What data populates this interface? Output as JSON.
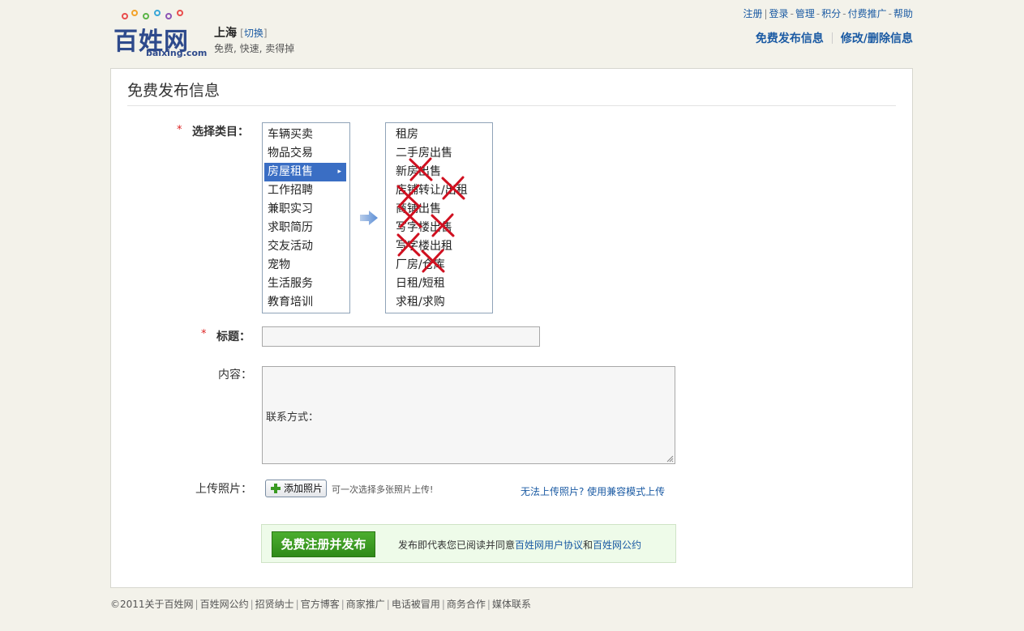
{
  "header": {
    "logo_text": "百姓网",
    "logo_domain": "baixing.com",
    "city": "上海",
    "switch_label": "切换",
    "slogan": "免费, 快速, 卖得掉",
    "top_links": [
      "注册",
      "登录",
      "管理",
      "积分",
      "付费推广",
      "帮助"
    ],
    "main_links": [
      "免费发布信息",
      "修改/删除信息"
    ]
  },
  "form": {
    "heading": "免费发布信息",
    "category_label": "选择类目：",
    "categories": [
      "车辆买卖",
      "物品交易",
      "房屋租售",
      "工作招聘",
      "兼职实习",
      "求职简历",
      "交友活动",
      "宠物",
      "生活服务",
      "教育培训"
    ],
    "selected_category": "房屋租售",
    "subcategories": [
      "租房",
      "二手房出售",
      "新房出售",
      "店铺转让/出租",
      "商铺出售",
      "写字楼出售",
      "写字楼出租",
      "厂房/仓库",
      "日租/短租",
      "求租/求购"
    ],
    "title_label": "标题：",
    "title_value": "",
    "content_label": "内容：",
    "content_value": "联系方式：",
    "photo_label": "上传照片：",
    "photo_button": "添加照片",
    "photo_hint": "可一次选择多张照片上传!",
    "photo_compat_link": "无法上传照片? 使用兼容模式上传",
    "submit_button": "免费注册并发布",
    "agree_prefix": "发布即代表您已阅读并同意",
    "agree_link1": "百姓网用户协议",
    "agree_and": "和",
    "agree_link2": "百姓网公约"
  },
  "footer": {
    "copyright": "©2011关于百姓网",
    "links": [
      "百姓网公约",
      "招贤纳士",
      "官方博客",
      "商家推广",
      "电话被冒用",
      "商务合作",
      "媒体联系"
    ]
  },
  "colors": {
    "link": "#1a5aa3",
    "selected": "#3a6ec4",
    "required": "#d22222",
    "submit": "#3a9a22",
    "cross_mark": "#d01020"
  }
}
